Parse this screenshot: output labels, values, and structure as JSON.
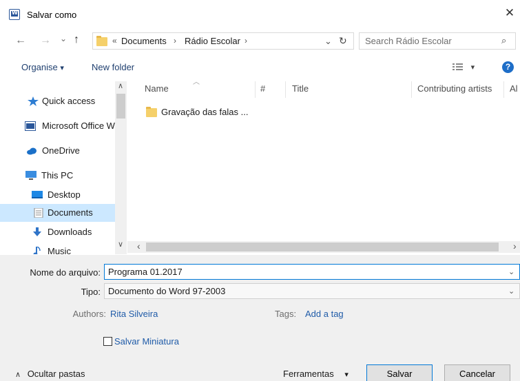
{
  "window": {
    "title": "Salvar como",
    "close_glyph": "✕"
  },
  "nav": {
    "back": "←",
    "forward": "→",
    "recent": "⌄",
    "up": "↑",
    "breadcrumb_overflow": "«",
    "breadcrumbs": [
      "Documents",
      "Rádio Escolar"
    ],
    "crumb_sep": "›",
    "dropdown": "⌄",
    "refresh": "↻",
    "search_placeholder": "Search Rádio Escolar",
    "search_icon": "⌕"
  },
  "toolbar": {
    "organise": "Organise",
    "organise_arrow": "▾",
    "new_folder": "New folder",
    "view_arrow": "▾",
    "help": "?"
  },
  "sidebar": {
    "items": [
      {
        "label": "Quick access",
        "icon": "star-icon"
      },
      {
        "label": "Microsoft Office W",
        "icon": "word-icon"
      },
      {
        "label": "OneDrive",
        "icon": "cloud-icon"
      },
      {
        "label": "This PC",
        "icon": "computer-icon"
      },
      {
        "label": "Desktop",
        "icon": "desktop-icon"
      },
      {
        "label": "Documents",
        "icon": "documents-icon"
      },
      {
        "label": "Downloads",
        "icon": "download-icon"
      },
      {
        "label": "Music",
        "icon": "music-icon"
      }
    ],
    "selected_index": 5
  },
  "columns": {
    "name": "Name",
    "number": "#",
    "title": "Title",
    "contributing_artists": "Contributing artists",
    "album": "Al"
  },
  "files": [
    {
      "name": "Gravação das falas ..."
    }
  ],
  "form": {
    "filename_label": "Nome do arquivo:",
    "filename_value": "Programa 01.2017",
    "type_label": "Tipo:",
    "type_value": "Documento do Word 97-2003",
    "authors_label": "Authors:",
    "authors_value": "Rita Silveira",
    "tags_label": "Tags:",
    "tags_value": "Add a tag",
    "thumbnail_label": "Salvar Miniatura",
    "dropdown_glyph": "⌄"
  },
  "footer": {
    "hide_folders_glyph": "∧",
    "hide_folders": "Ocultar pastas",
    "tools": "Ferramentas",
    "tools_arrow": "▾",
    "save": "Salvar",
    "cancel": "Cancelar"
  },
  "scroll_glyphs": {
    "up": "∧",
    "down": "∨",
    "left": "‹",
    "right": "›"
  },
  "colors": {
    "accent": "#0078d7",
    "selection": "#cce8ff",
    "link": "#1f5ba8",
    "folder": "#f5d06a"
  }
}
